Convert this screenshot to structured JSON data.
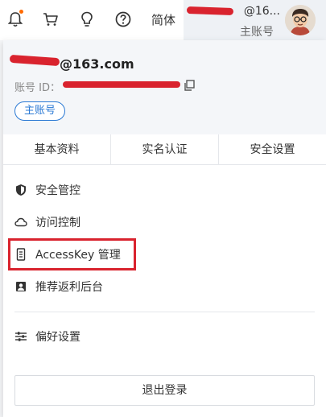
{
  "topbar": {
    "lang": "简体",
    "user_name": "@16...",
    "account_type": "主账号"
  },
  "account": {
    "email": "@163.com",
    "id_label": "账号 ID：",
    "badge": "主账号"
  },
  "tabs": [
    "基本资料",
    "实名认证",
    "安全设置"
  ],
  "menu": {
    "items": [
      {
        "label": "安全管控",
        "icon": "shield-icon"
      },
      {
        "label": "访问控制",
        "icon": "cloud-icon"
      },
      {
        "label": "AccessKey 管理",
        "icon": "key-card-icon"
      },
      {
        "label": "推荐返利后台",
        "icon": "portrait-icon"
      },
      {
        "label": "偏好设置",
        "icon": "sliders-icon"
      }
    ]
  },
  "logout_label": "退出登录",
  "colors": {
    "highlight": "#d9232e",
    "badge": "#2a79d4",
    "notification_dot": "#ff6a00"
  }
}
